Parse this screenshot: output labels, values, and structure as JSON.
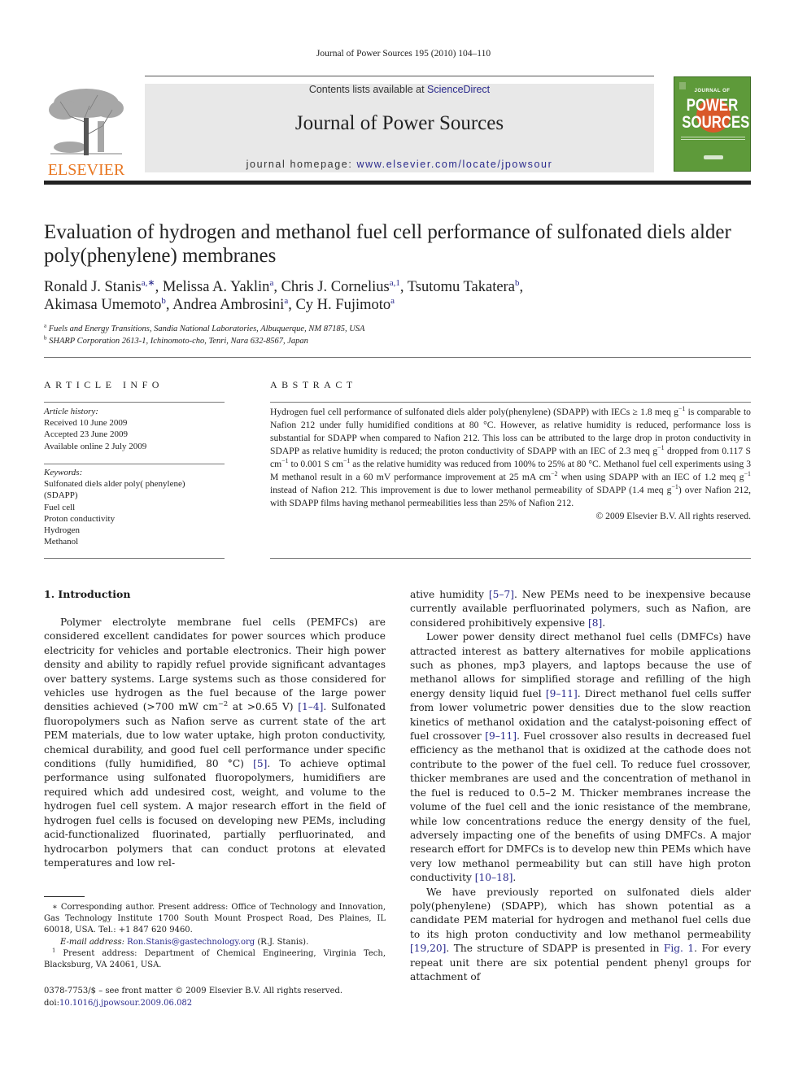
{
  "running_head": "Journal of Power Sources 195 (2010) 104–110",
  "masthead": {
    "publisher_name": "ELSEVIER",
    "contents_prefix": "Contents lists available at ",
    "contents_link": "ScienceDirect",
    "journal_title": "Journal of Power Sources",
    "homepage_prefix": "journal homepage: ",
    "homepage_url": "www.elsevier.com/locate/jpowsour",
    "cover": {
      "line1": "JOURNAL OF",
      "line2": "POWER",
      "line3": "SOURCES",
      "color": "#5e9a3a",
      "accent": "#d9582b"
    },
    "elsevier_color": "#e87722",
    "link_color": "#2a2a8c"
  },
  "article": {
    "title": "Evaluation of hydrogen and methanol fuel cell performance of sulfonated diels alder poly(phenylene) membranes",
    "authors": [
      {
        "name": "Ronald J. Stanis",
        "marks": "a,∗",
        "sep": ", "
      },
      {
        "name": "Melissa A. Yaklin",
        "marks": "a",
        "sep": ", "
      },
      {
        "name": "Chris J. Cornelius",
        "marks": "a,1",
        "sep": ", "
      },
      {
        "name": "Tsutomu Takatera",
        "marks": "b",
        "sep": ","
      },
      {
        "name": "Akimasa Umemoto",
        "marks": "b",
        "sep": ", "
      },
      {
        "name": "Andrea Ambrosini",
        "marks": "a",
        "sep": ", "
      },
      {
        "name": "Cy H. Fujimoto",
        "marks": "a",
        "sep": ""
      }
    ],
    "affiliations": [
      {
        "mark": "a",
        "text": "Fuels and Energy Transitions, Sandia National Laboratories, Albuquerque, NM 87185, USA"
      },
      {
        "mark": "b",
        "text": "SHARP Corporation 2613-1, Ichinomoto-cho, Tenri, Nara 632-8567, Japan"
      }
    ]
  },
  "article_info": {
    "heading": "ARTICLE INFO",
    "history_label": "Article history:",
    "history": [
      "Received 10 June 2009",
      "Accepted 23 June 2009",
      "Available online 2 July 2009"
    ],
    "keywords_label": "Keywords:",
    "keywords": [
      "Sulfonated diels alder poly( phenylene)",
      "(SDAPP)",
      "Fuel cell",
      "Proton conductivity",
      "Hydrogen",
      "Methanol"
    ]
  },
  "abstract": {
    "heading": "ABSTRACT",
    "text_parts": [
      "Hydrogen fuel cell performance of sulfonated diels alder poly(phenylene) (SDAPP) with IECs ≥ 1.8 meq g",
      "−1",
      " is comparable to Nafion 212 under fully humidified conditions at 80 °C. However, as relative humidity is reduced, performance loss is substantial for SDAPP when compared to Nafion 212. This loss can be attributed to the large drop in proton conductivity in SDAPP as relative humidity is reduced; the proton conductivity of SDAPP with an IEC of 2.3 meq g",
      "−1",
      " dropped from 0.117 S cm",
      "−1",
      " to 0.001 S cm",
      "−1",
      " as the relative humidity was reduced from 100% to 25% at 80 °C. Methanol fuel cell experiments using 3 M methanol result in a 60 mV performance improvement at 25 mA cm",
      "−2",
      " when using SDAPP with an IEC of 1.2 meq g",
      "−1",
      " instead of Nafion 212. This improvement is due to lower methanol permeability of SDAPP (1.4 meq g",
      "−1",
      ") over Nafion 212, with SDAPP films having methanol permeabilities less than 25% of Nafion 212."
    ],
    "copyright": "© 2009 Elsevier B.V. All rights reserved."
  },
  "introduction": {
    "heading": "1.  Introduction",
    "left_para1": [
      {
        "t": "Polymer electrolyte membrane fuel cells (PEMFCs) are considered excellent candidates for power sources which produce electricity for vehicles and portable electronics. Their high power density and ability to rapidly refuel provide significant advantages over battery systems. Large systems such as those considered for vehicles use hydrogen as the fuel because of the large power densities achieved (>700 mW cm"
      },
      {
        "sup": "−2"
      },
      {
        "t": " at >0.65 V) "
      },
      {
        "ref": "[1–4]"
      },
      {
        "t": ". Sulfonated fluoropolymers such as Nafion serve as current state of the art PEM materials, due to low water uptake, high proton conductivity, chemical durability, and good fuel cell performance under specific conditions (fully humidified, 80 °C) "
      },
      {
        "ref": "[5]"
      },
      {
        "t": ". To achieve optimal performance using sulfonated fluoropolymers, humidifiers are required which add undesired cost, weight, and volume to the hydrogen fuel cell system. A major research effort in the field of hydrogen fuel cells is focused on developing new PEMs, including acid-functionalized fluorinated, partially perfluorinated, and hydrocarbon polymers that can conduct protons at elevated temperatures and low rel-"
      }
    ],
    "right_para0": [
      {
        "t": "ative humidity "
      },
      {
        "ref": "[5–7]"
      },
      {
        "t": ". New PEMs need to be inexpensive because currently available perfluorinated polymers, such as Nafion, are considered prohibitively expensive "
      },
      {
        "ref": "[8]"
      },
      {
        "t": "."
      }
    ],
    "right_para1": [
      {
        "t": "Lower power density direct methanol fuel cells (DMFCs) have attracted interest as battery alternatives for mobile applications such as phones, mp3 players, and laptops because the use of methanol allows for simplified storage and refilling of the high energy density liquid fuel "
      },
      {
        "ref": "[9–11]"
      },
      {
        "t": ". Direct methanol fuel cells suffer from lower volumetric power densities due to the slow reaction kinetics of methanol oxidation and the catalyst-poisoning effect of fuel crossover "
      },
      {
        "ref": "[9–11]"
      },
      {
        "t": ". Fuel crossover also results in decreased fuel efficiency as the methanol that is oxidized at the cathode does not contribute to the power of the fuel cell. To reduce fuel crossover, thicker membranes are used and the concentration of methanol in the fuel is reduced to 0.5–2 M. Thicker membranes increase the volume of the fuel cell and the ionic resistance of the membrane, while low concentrations reduce the energy density of the fuel, adversely impacting one of the benefits of using DMFCs. A major research effort for DMFCs is to develop new thin PEMs which have very low methanol permeability but can still have high proton conductivity "
      },
      {
        "ref": "[10–18]"
      },
      {
        "t": "."
      }
    ],
    "right_para2": [
      {
        "t": "We have previously reported on sulfonated diels alder poly(phenylene) (SDAPP), which has shown potential as a candidate PEM material for hydrogen and methanol fuel cells due to its high proton conductivity and low methanol permeability "
      },
      {
        "ref": "[19,20]"
      },
      {
        "t": ". The structure of SDAPP is presented in "
      },
      {
        "ref": "Fig. 1"
      },
      {
        "t": ". For every repeat unit there are six potential pendent phenyl groups for attachment of"
      }
    ]
  },
  "footnotes": {
    "corresponding": "∗  Corresponding author. Present address: Office of Technology and Innovation, Gas Technology Institute 1700 South Mount Prospect Road, Des Plaines, IL 60018, USA. Tel.: +1 847 620 9460.",
    "email_label": "E-mail address: ",
    "email": "Ron.Stanis@gastechnology.org",
    "email_suffix": " (R.J. Stanis).",
    "note1_mark": "1",
    "note1": " Present address: Department of Chemical Engineering, Virginia Tech, Blacksburg, VA 24061, USA."
  },
  "front_matter": {
    "issn_line": "0378-7753/$ – see front matter © 2009 Elsevier B.V. All rights reserved.",
    "doi_label": "doi:",
    "doi": "10.1016/j.jpowsour.2009.06.082"
  }
}
